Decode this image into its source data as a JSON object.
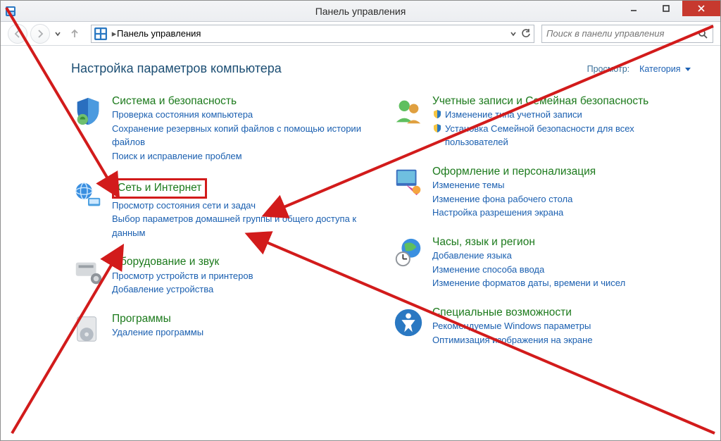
{
  "window": {
    "title": "Панель управления"
  },
  "breadcrumb": {
    "root": "Панель управления"
  },
  "search": {
    "placeholder": "Поиск в панели управления"
  },
  "heading": "Настройка параметров компьютера",
  "viewby": {
    "label": "Просмотр:",
    "value": "Категория"
  },
  "left": [
    {
      "title": "Система и безопасность",
      "links": [
        "Проверка состояния компьютера",
        "Сохранение резервных копий файлов с помощью истории файлов",
        "Поиск и исправление проблем"
      ]
    },
    {
      "title": "Сеть и Интернет",
      "links": [
        "Просмотр состояния сети и задач",
        "Выбор параметров домашней группы и общего доступа к данным"
      ]
    },
    {
      "title": "Оборудование и звук",
      "links": [
        "Просмотр устройств и принтеров",
        "Добавление устройства"
      ]
    },
    {
      "title": "Программы",
      "links": [
        "Удаление программы"
      ]
    }
  ],
  "right": [
    {
      "title": "Учетные записи и Семейная безопасность",
      "links": [
        "Изменение типа учетной записи",
        "Установка Семейной безопасности для всех пользователей"
      ],
      "shield": [
        true,
        true
      ]
    },
    {
      "title": "Оформление и персонализация",
      "links": [
        "Изменение темы",
        "Изменение фона рабочего стола",
        "Настройка разрешения экрана"
      ]
    },
    {
      "title": "Часы, язык и регион",
      "links": [
        "Добавление языка",
        "Изменение способа ввода",
        "Изменение форматов даты, времени и чисел"
      ]
    },
    {
      "title": "Специальные возможности",
      "links": [
        "Рекомендуемые Windows параметры",
        "Оптимизация изображения на экране"
      ]
    }
  ]
}
